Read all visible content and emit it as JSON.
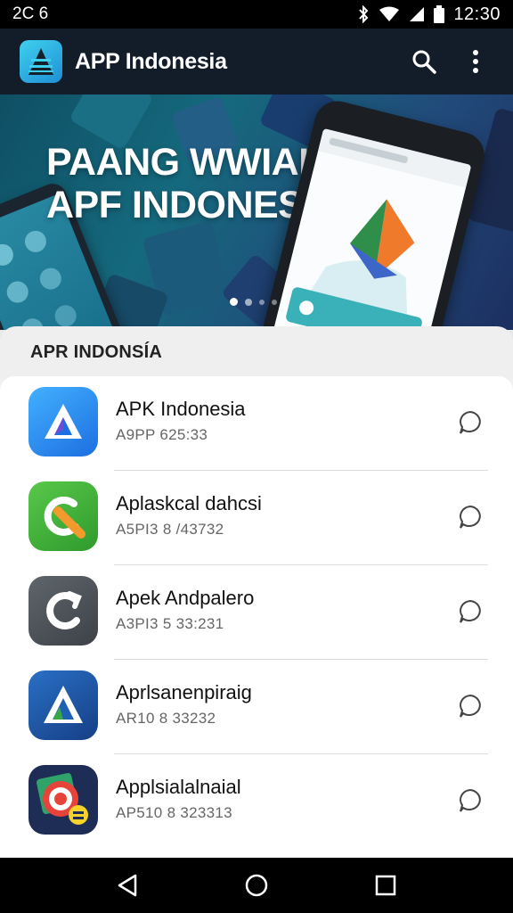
{
  "status_bar": {
    "left_text": "2C 6",
    "time": "12:30",
    "icons": [
      "bluetooth-icon",
      "wifi-icon",
      "signal-icon",
      "battery-icon"
    ]
  },
  "app_bar": {
    "title": "APP Indonesia",
    "logo_icon": "app-logo-icon",
    "actions": [
      "search-icon",
      "more-vert-icon"
    ]
  },
  "banner": {
    "line1": "PAANG WWIAK",
    "line2": "APF INDONESIA",
    "page_count": 4,
    "active_page": 1
  },
  "section": {
    "title": "APR INDONSÍA"
  },
  "apps": [
    {
      "name": "APK Indonesia",
      "sub": "A9PP 625:33",
      "icon": "triangle-logo-icon",
      "color": "#2a8fe8"
    },
    {
      "name": "Aplaskcal dahcsi",
      "sub": "A5PI3 8 /43732",
      "icon": "green-c-logo-icon",
      "color": "#3fae3a"
    },
    {
      "name": "Apek Andpalero",
      "sub": "A3PI3 5 33:231",
      "icon": "grey-c-logo-icon",
      "color": "#4d5359"
    },
    {
      "name": "Aprlsanenpiraig",
      "sub": "AR10 8 33232",
      "icon": "blue-a-logo-icon",
      "color": "#1d5aa6"
    },
    {
      "name": "Applsialalnaial",
      "sub": "AP510 8 323313",
      "icon": "target-logo-icon",
      "color": "#1d2d55"
    }
  ],
  "nav": {
    "buttons": [
      "back-icon",
      "home-icon",
      "recents-icon"
    ]
  },
  "colors": {
    "app_bar": "#131d2a",
    "status_bar": "#000000",
    "banner_start": "#0f4f64",
    "banner_end": "#1c2f60"
  }
}
